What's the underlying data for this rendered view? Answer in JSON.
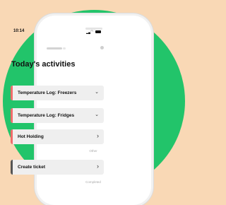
{
  "colors": {
    "background": "#f9d8b5",
    "circle": "#22c46a",
    "alert_bar": "#f06b6b",
    "neutral_bar": "#555555",
    "card": "#efefef"
  },
  "status": {
    "time": "10:14"
  },
  "screen": {
    "title": "Today's activities",
    "activities": [
      {
        "label": "Temperature Log: Freezers",
        "icon": "chevron-down-icon",
        "glyph": "⌄"
      },
      {
        "label": "Temperature Log: Fridges",
        "icon": "chevron-down-icon",
        "glyph": "⌄"
      },
      {
        "label": "Hot Holding",
        "icon": "chevron-right-icon",
        "glyph": "›"
      }
    ],
    "other_label": "Other",
    "other_items": [
      {
        "label": "Create ticket",
        "icon": "chevron-right-icon",
        "glyph": "›"
      }
    ],
    "completed_label": "Completed"
  }
}
